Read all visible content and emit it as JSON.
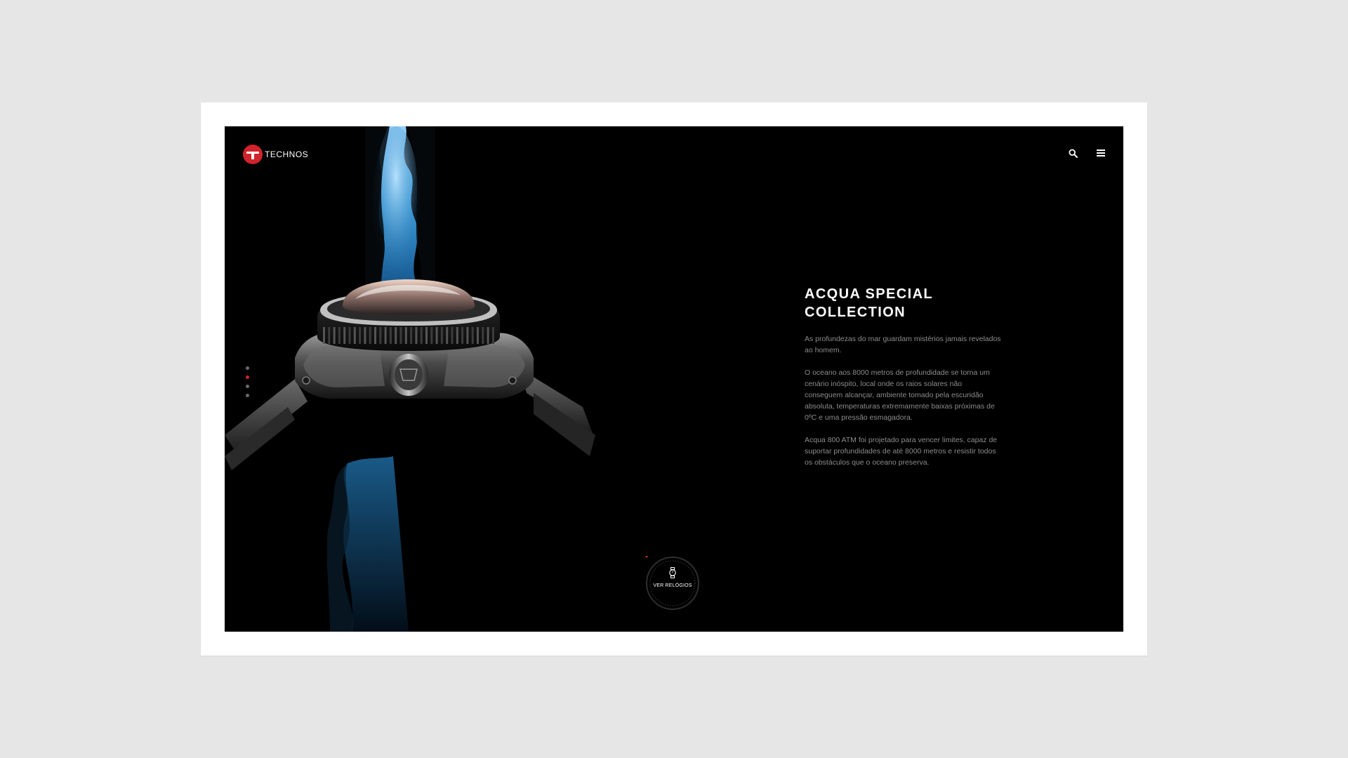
{
  "brand": {
    "name": "TECHNOS",
    "accent_color": "#d0232b"
  },
  "header": {
    "search_icon": "search-icon",
    "menu_icon": "menu-icon"
  },
  "pager": {
    "count": 4,
    "active_index": 1
  },
  "hero": {
    "title_line1": "ACQUA SPECIAL",
    "title_line2": "COLLECTION",
    "paragraph1": "As profundezas do mar guardam mistérios jamais revelados ao homem.",
    "paragraph2": "O oceano aos 8000 metros de profundidade se torna um cenário inóspito, local onde os raios solares não conseguem alcançar, ambiente tomado pela escuridão absoluta, temperaturas extremamente baixas próximas de 0ºC e uma pressão esmagadora.",
    "paragraph3": "Acqua 800 ATM foi projetado para vencer limites, capaz de suportar profundidades de até 8000 metros e resistir todos os obstáculos que o oceano preserva."
  },
  "cta": {
    "label": "VER RELÓGIOS",
    "icon": "watch-icon"
  }
}
